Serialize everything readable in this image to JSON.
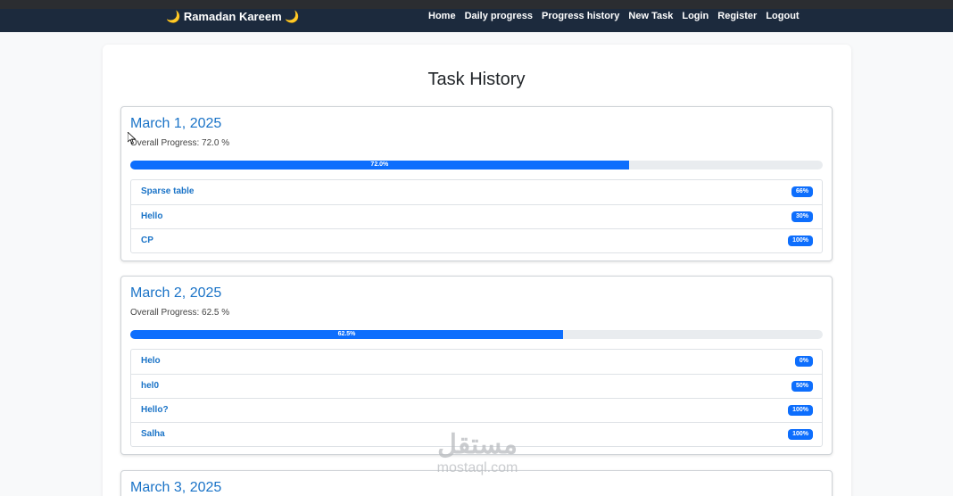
{
  "navbar": {
    "brand": "Ramadan Kareem",
    "moon_glyph": "🌙",
    "links": [
      "Home",
      "Daily progress",
      "Progress history",
      "New Task",
      "Login",
      "Register",
      "Logout"
    ]
  },
  "page": {
    "title": "Task History"
  },
  "days": [
    {
      "date": "March 1, 2025",
      "overall": "Overall Progress: 72.0 %",
      "progress_label": "72.0%",
      "progress": 72,
      "tasks": [
        {
          "name": "Sparse table",
          "badge": "66%"
        },
        {
          "name": "Hello",
          "badge": "30%"
        },
        {
          "name": "CP",
          "badge": "100%"
        }
      ]
    },
    {
      "date": "March 2, 2025",
      "overall": "Overall Progress: 62.5 %",
      "progress_label": "62.5%",
      "progress": 62.5,
      "tasks": [
        {
          "name": "Helo",
          "badge": "0%"
        },
        {
          "name": "hel0",
          "badge": "50%"
        },
        {
          "name": "Hello?",
          "badge": "100%"
        },
        {
          "name": "Salha",
          "badge": "100%"
        }
      ]
    },
    {
      "date": "March 3, 2025"
    }
  ],
  "watermark": {
    "arabic": "مستقل",
    "latin": "mostaql.com"
  },
  "colors": {
    "navbar": "#1c2a3d",
    "accent": "#0d6efd",
    "link": "#1a73c7"
  }
}
